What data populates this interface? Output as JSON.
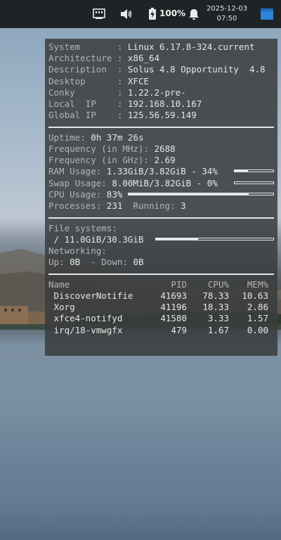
{
  "panel": {
    "battery_percent": "100%",
    "date": "2025-12-03",
    "time": "07:50"
  },
  "conky": {
    "system": [
      {
        "key": "System      ",
        "value": "Linux 6.17.8-324.current"
      },
      {
        "key": "Architecture",
        "value": "x86_64"
      },
      {
        "key": "Description ",
        "value": "Solus 4.8 Opportunity  4.8"
      },
      {
        "key": "Desktop     ",
        "value": "XFCE"
      },
      {
        "key": "Conky       ",
        "value": "1.22.2-pre-"
      },
      {
        "key": "Local  IP   ",
        "value": "192.168.10.167"
      },
      {
        "key": "Global IP   ",
        "value": "125.56.59.149"
      }
    ],
    "uptime_label": "Uptime: ",
    "uptime": "0h 37m 26s",
    "freq_mhz_label": "Frequency (in MHz): ",
    "freq_mhz": "2688",
    "freq_ghz_label": "Frequency (in GHz): ",
    "freq_ghz": "2.69",
    "ram_label": "RAM Usage: ",
    "ram": "1.33GiB/3.82GiB - 34%",
    "ram_fraction": 0.34,
    "swap_label": "Swap Usage: ",
    "swap": "8.00MiB/3.82GiB - 0%",
    "swap_fraction": 0.0,
    "cpu_label": "CPU Usage: ",
    "cpu": "83%",
    "cpu_fraction": 0.83,
    "processes_label": "Processes: ",
    "processes": "231",
    "running_label": "Running: ",
    "running": "3",
    "fs_label": "File systems:",
    "fs": " / 11.0GiB/30.3GiB",
    "fs_fraction": 0.36,
    "net_label": "Networking:",
    "up_label": "Up: ",
    "up": "0B",
    "down_label": "  - Down: ",
    "down": "0B",
    "proc_headers": {
      "name": "Name",
      "pid": "PID",
      "cpu": "CPU%",
      "mem": "MEM%"
    },
    "proc_rows": [
      {
        "name": " DiscoverNotifie",
        "pid": "41693",
        "cpu": "78.33",
        "mem": "10.63"
      },
      {
        "name": " Xorg",
        "pid": "41196",
        "cpu": "18.33",
        "mem": "2.86"
      },
      {
        "name": " xfce4-notifyd",
        "pid": "41580",
        "cpu": "3.33",
        "mem": "1.57"
      },
      {
        "name": " irq/18-vmwgfx",
        "pid": "479",
        "cpu": "1.67",
        "mem": "0.00"
      }
    ]
  },
  "icons": [
    "network-icon",
    "volume-icon",
    "battery-icon",
    "notification-bell-icon",
    "show-desktop-icon"
  ]
}
